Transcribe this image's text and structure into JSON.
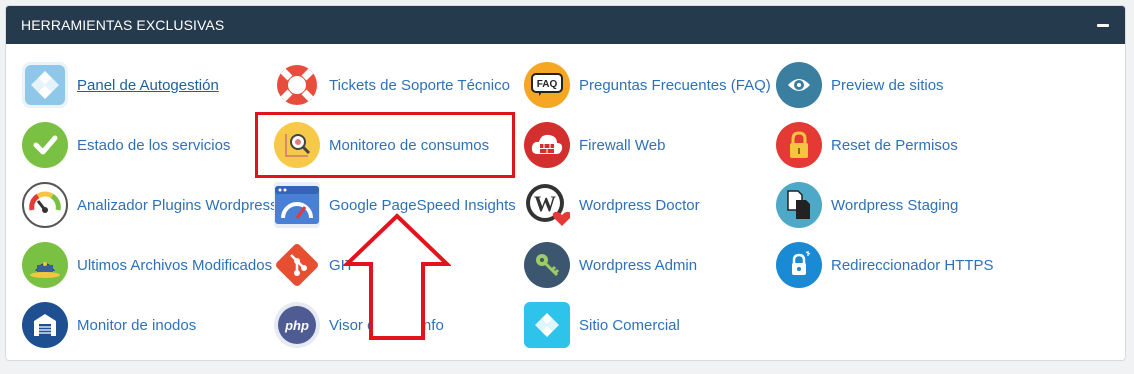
{
  "panel": {
    "title": "HERRAMIENTAS EXCLUSIVAS"
  },
  "tools": [
    {
      "label": "Panel de Autogestión",
      "icon": "autogestion-icon"
    },
    {
      "label": "Tickets de Soporte Técnico",
      "icon": "lifebuoy-icon"
    },
    {
      "label": "Preguntas Frecuentes (FAQ)",
      "icon": "faq-icon"
    },
    {
      "label": "Preview de sitios",
      "icon": "eye-icon"
    },
    {
      "label": "Estado de los servicios",
      "icon": "check-icon"
    },
    {
      "label": "Monitoreo de consumos",
      "icon": "magnifier-chart-icon"
    },
    {
      "label": "Firewall Web",
      "icon": "firewall-cloud-icon"
    },
    {
      "label": "Reset de Permisos",
      "icon": "padlock-icon"
    },
    {
      "label": "Analizador Plugins Wordpress",
      "icon": "gauge-icon"
    },
    {
      "label": "Google PageSpeed Insights",
      "icon": "pagespeed-icon"
    },
    {
      "label": "Wordpress Doctor",
      "icon": "wordpress-heart-icon"
    },
    {
      "label": "Wordpress Staging",
      "icon": "staging-files-icon"
    },
    {
      "label": "Ultimos Archivos Modificados",
      "icon": "files-stack-icon"
    },
    {
      "label": "GIT",
      "icon": "git-icon"
    },
    {
      "label": "Wordpress Admin",
      "icon": "key-icon"
    },
    {
      "label": "Redireccionador HTTPS",
      "icon": "https-lock-icon"
    },
    {
      "label": "Monitor de inodos",
      "icon": "warehouse-icon"
    },
    {
      "label": "Visor de PHPInfo",
      "icon": "php-icon"
    },
    {
      "label": "Sitio Comercial",
      "icon": "diamond-icon"
    }
  ]
}
